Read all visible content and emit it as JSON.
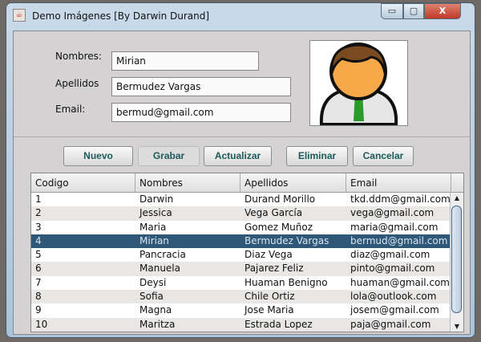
{
  "window": {
    "title": "Demo Imágenes [By Darwin Durand]",
    "minimize": "▭",
    "maximize": "▢",
    "close": "X"
  },
  "form": {
    "nombres_label": "Nombres:",
    "nombres_value": "Mirian",
    "apellidos_label": "Apellidos",
    "apellidos_value": "Bermudez Vargas",
    "email_label": "Email:",
    "email_value": "bermud@gmail.com"
  },
  "buttons": {
    "nuevo": "Nuevo",
    "grabar": "Grabar",
    "actualizar": "Actualizar",
    "eliminar": "Eliminar",
    "cancelar": "Cancelar"
  },
  "table": {
    "columns": [
      "Codigo",
      "Nombres",
      "Apellidos",
      "Email"
    ],
    "selected_index": 3,
    "rows": [
      [
        "1",
        "Darwin",
        "Durand Morillo",
        "tkd.ddm@gmail.com"
      ],
      [
        "2",
        "Jessica",
        "Vega García",
        "vega@gmail.com"
      ],
      [
        "3",
        "Maria",
        "Gomez Muñoz",
        "maria@gmail.com"
      ],
      [
        "4",
        "Mirian",
        "Bermudez Vargas",
        "bermud@gmail.com"
      ],
      [
        "5",
        "Pancracia",
        "Diaz Vega",
        "diaz@gmail.com"
      ],
      [
        "6",
        "Manuela",
        "Pajarez Feliz",
        "pinto@gmail.com"
      ],
      [
        "7",
        "Deysi",
        "Huaman Benigno",
        "huaman@gmail.com"
      ],
      [
        "8",
        "Sofia",
        "Chile Ortiz",
        "lola@outlook.com"
      ],
      [
        "9",
        "Magna",
        "Jose Maria",
        "josem@gmail.com"
      ],
      [
        "10",
        "Maritza",
        "Estrada Lopez",
        "paja@gmail.com"
      ]
    ]
  },
  "colors": {
    "selection": "#2f5878",
    "button_text": "#1d5a5a"
  }
}
